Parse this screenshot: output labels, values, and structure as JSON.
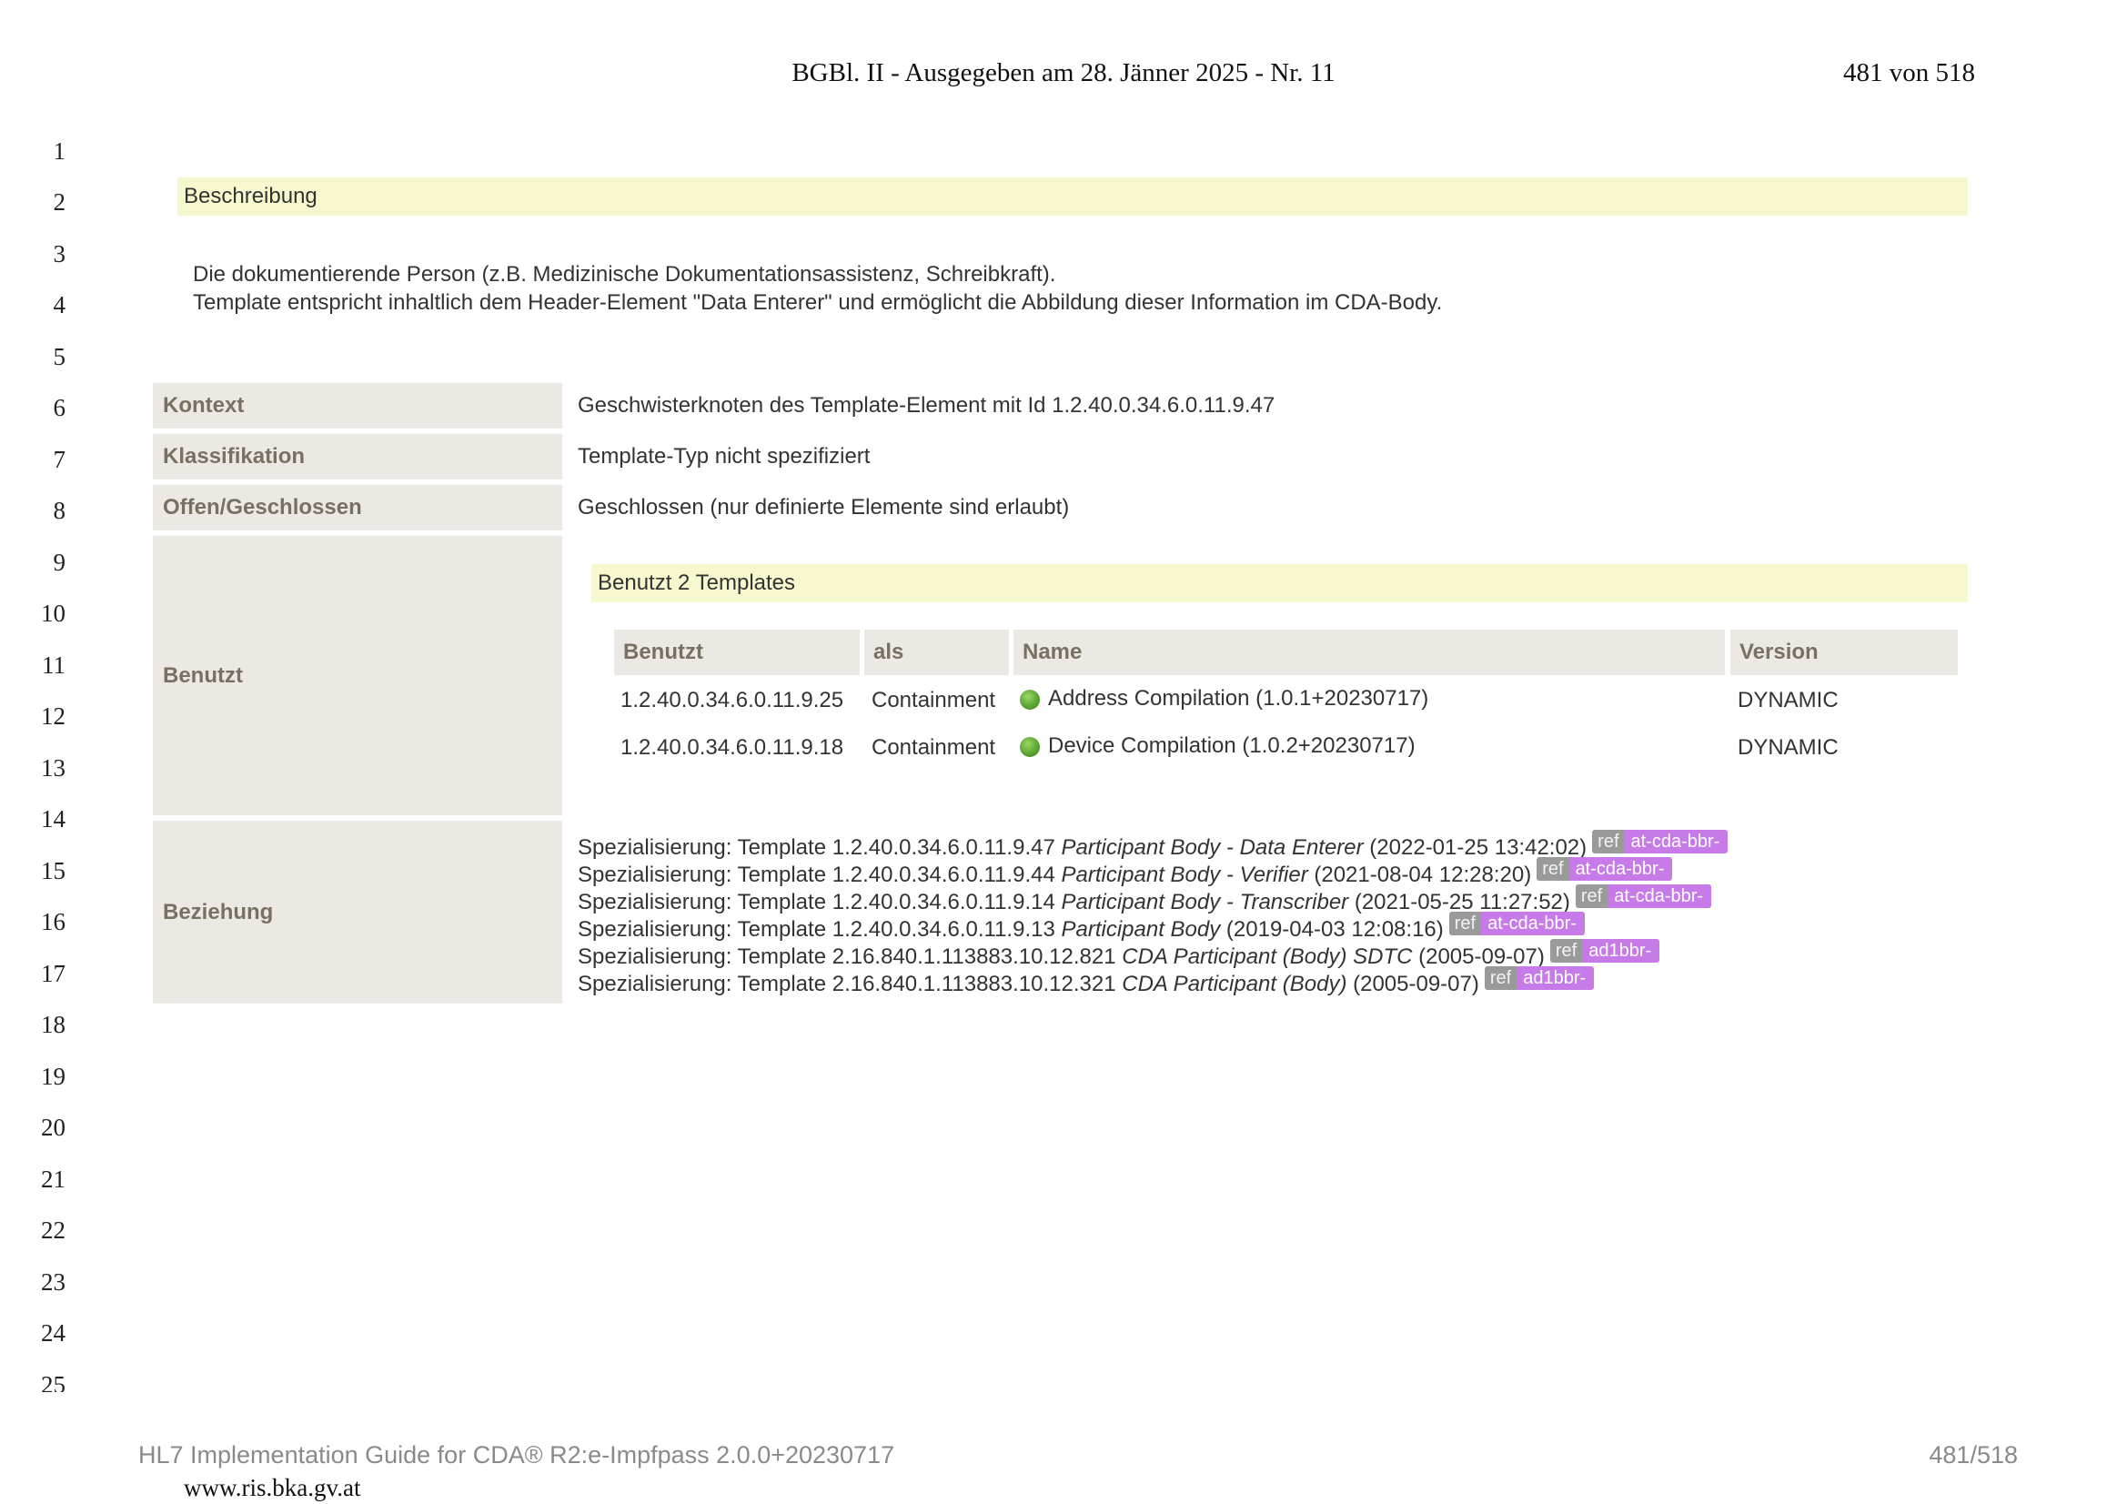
{
  "header": {
    "title": "BGBl. II - Ausgegeben am 28. Jänner 2025 - Nr. 11",
    "page": "481 von 518"
  },
  "line_numbers": [
    "1",
    "2",
    "3",
    "4",
    "5",
    "6",
    "7",
    "8",
    "9",
    "10",
    "11",
    "12",
    "13",
    "14",
    "15",
    "16",
    "17",
    "18",
    "19",
    "20",
    "21",
    "22",
    "23",
    "24",
    "25"
  ],
  "beschreibung": {
    "title": "Beschreibung",
    "lines": [
      "Die dokumentierende Person (z.B. Medizinische Dokumentationsassistenz, Schreibkraft).",
      "Template entspricht inhaltlich dem Header-Element \"Data Enterer\" und ermöglicht die Abbildung dieser Information im CDA-Body."
    ]
  },
  "properties": {
    "kontext": {
      "label": "Kontext",
      "value": "Geschwisterknoten des Template-Element mit Id 1.2.40.0.34.6.0.11.9.47"
    },
    "klassifikation": {
      "label": "Klassifikation",
      "value": "Template-Typ nicht spezifiziert"
    },
    "offen": {
      "label": "Offen/Geschlossen",
      "value": "Geschlossen (nur definierte Elemente sind erlaubt)"
    },
    "benutzt": {
      "label": "Benutzt"
    },
    "beziehung": {
      "label": "Beziehung"
    }
  },
  "uses": {
    "title": "Benutzt 2 Templates",
    "columns": {
      "benutzt": "Benutzt",
      "als": "als",
      "name": "Name",
      "version": "Version"
    },
    "rows": [
      {
        "id": "1.2.40.0.34.6.0.11.9.25",
        "als": "Containment",
        "name": "Address Compilation (1.0.1+20230717)",
        "version": "DYNAMIC",
        "status_color": "#5aa532"
      },
      {
        "id": "1.2.40.0.34.6.0.11.9.18",
        "als": "Containment",
        "name": "Device Compilation (1.0.2+20230717)",
        "version": "DYNAMIC",
        "status_color": "#5aa532"
      }
    ]
  },
  "relations": [
    {
      "prefix": "Spezialisierung: Template 1.2.40.0.34.6.0.11.9.47 ",
      "name": "Participant Body - Data Enterer",
      "date": " (2022‑01‑25 13:42:02)",
      "ref": "ref",
      "prefix_badge": "at-cda-bbr-"
    },
    {
      "prefix": "Spezialisierung: Template 1.2.40.0.34.6.0.11.9.44 ",
      "name": "Participant Body - Verifier",
      "date": " (2021‑08‑04 12:28:20)",
      "ref": "ref",
      "prefix_badge": "at-cda-bbr-"
    },
    {
      "prefix": "Spezialisierung: Template 1.2.40.0.34.6.0.11.9.14 ",
      "name": "Participant Body - Transcriber",
      "date": " (2021‑05‑25 11:27:52)",
      "ref": "ref",
      "prefix_badge": "at-cda-bbr-"
    },
    {
      "prefix": "Spezialisierung: Template 1.2.40.0.34.6.0.11.9.13 ",
      "name": "Participant Body",
      "date": " (2019‑04‑03 12:08:16)",
      "ref": "ref",
      "prefix_badge": "at-cda-bbr-"
    },
    {
      "prefix": "Spezialisierung: Template 2.16.840.1.113883.10.12.821 ",
      "name": "CDA Participant (Body) SDTC",
      "date": " (2005‑09‑07)",
      "ref": "ref",
      "prefix_badge": "ad1bbr-"
    },
    {
      "prefix": "Spezialisierung: Template 2.16.840.1.113883.10.12.321 ",
      "name": "CDA Participant (Body)",
      "date": " (2005‑09‑07)",
      "ref": "ref",
      "prefix_badge": "ad1bbr-"
    }
  ],
  "footer": {
    "guide": "HL7 Implementation Guide for CDA® R2:e-Impfpass 2.0.0+20230717",
    "page": "481/518",
    "url": "www.ris.bka.gv.at"
  },
  "colors": {
    "section_bar": "#f8f8cf",
    "label_cell": "#ece9e4",
    "label_text": "#7a6f63",
    "ref_badge": "#9a9a9a",
    "prefix_badge": "#c77be8"
  }
}
